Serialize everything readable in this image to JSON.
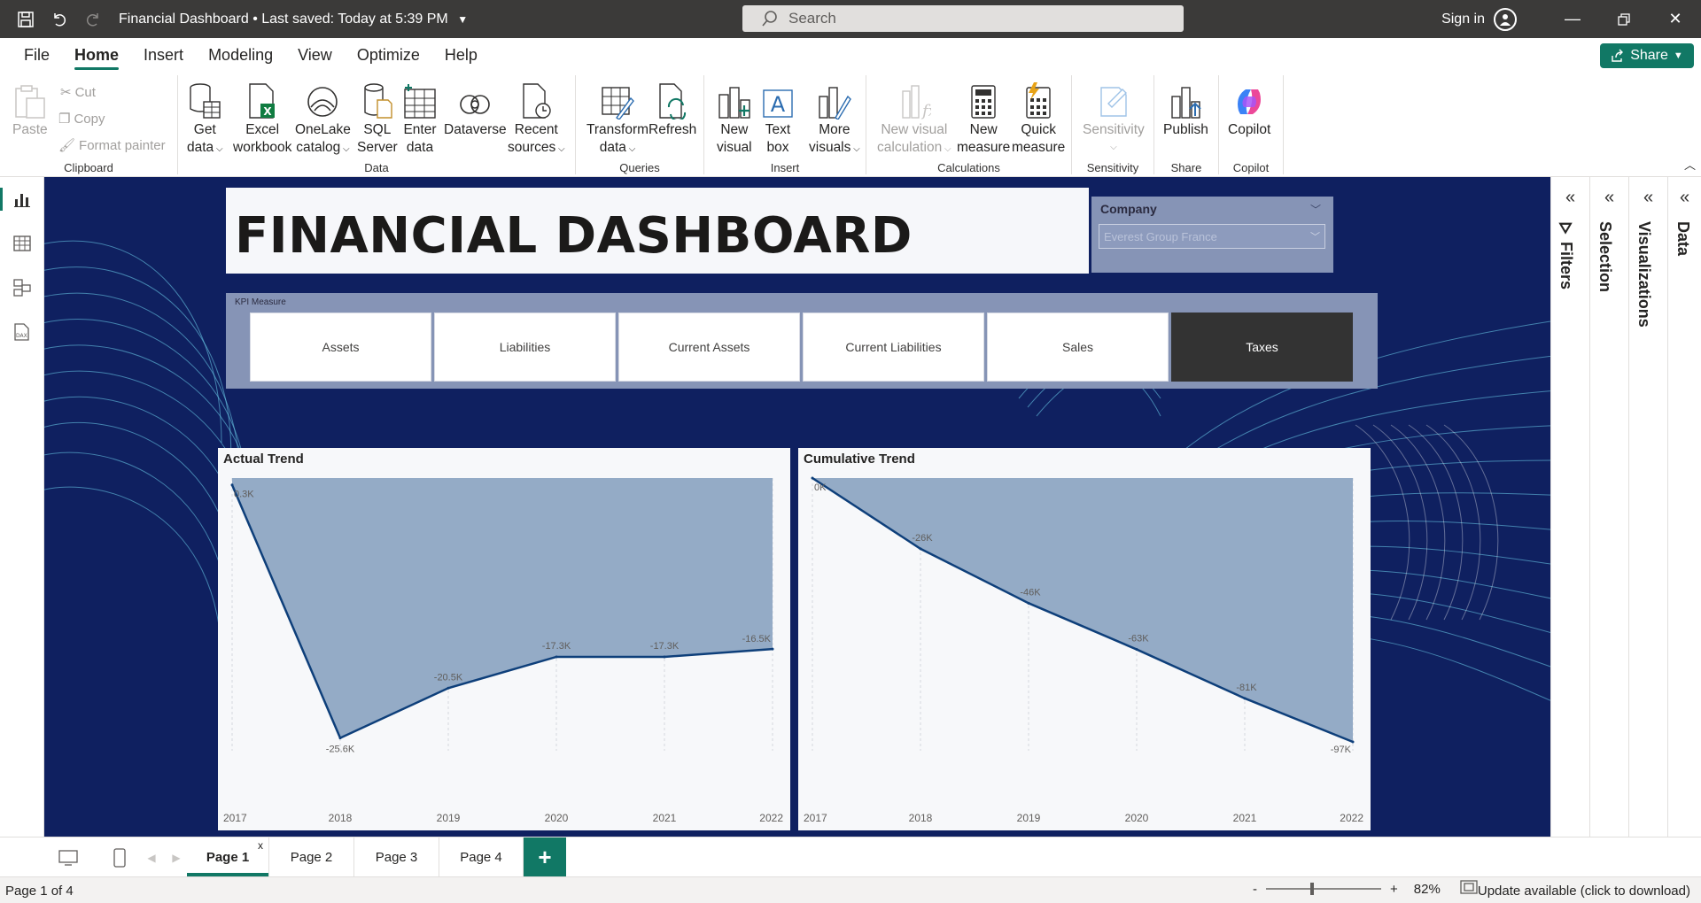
{
  "titlebar": {
    "file_title": "Financial Dashboard",
    "saved_status": "Last saved: Today at 5:39 PM",
    "search_placeholder": "Search",
    "sign_in": "Sign in"
  },
  "menu": {
    "items": [
      "File",
      "Home",
      "Insert",
      "Modeling",
      "View",
      "Optimize",
      "Help"
    ],
    "active": "Home",
    "share": "Share"
  },
  "ribbon": {
    "clipboard": {
      "paste": "Paste",
      "cut": "Cut",
      "copy": "Copy",
      "format_painter": "Format painter",
      "label": "Clipboard"
    },
    "data": {
      "get_data": [
        "Get",
        "data"
      ],
      "excel": [
        "Excel",
        "workbook"
      ],
      "onelake": [
        "OneLake",
        "catalog"
      ],
      "sql": [
        "SQL",
        "Server"
      ],
      "enter": [
        "Enter",
        "data"
      ],
      "dataverse": [
        "Dataverse",
        ""
      ],
      "recent": [
        "Recent",
        "sources"
      ],
      "label": "Data"
    },
    "queries": {
      "transform": [
        "Transform",
        "data"
      ],
      "refresh": [
        "Refresh",
        ""
      ],
      "label": "Queries"
    },
    "insert": {
      "new_visual": [
        "New",
        "visual"
      ],
      "text_box": [
        "Text",
        "box"
      ],
      "more_visuals": [
        "More",
        "visuals"
      ],
      "label": "Insert"
    },
    "calculations": {
      "new_visual_calc": [
        "New visual",
        "calculation"
      ],
      "new_measure": [
        "New",
        "measure"
      ],
      "quick_measure": [
        "Quick",
        "measure"
      ],
      "label": "Calculations"
    },
    "sensitivity": {
      "button": "Sensitivity",
      "label": "Sensitivity"
    },
    "share": {
      "publish": "Publish",
      "label": "Share"
    },
    "copilot": {
      "button": "Copilot",
      "label": "Copilot"
    }
  },
  "report": {
    "title": "FINANCIAL DASHBOARD",
    "slicer": {
      "label": "Company",
      "value": "Everest Group France"
    },
    "kpi": {
      "label": "KPI Measure",
      "options": [
        "Assets",
        "Liabilities",
        "Current Assets",
        "Current Liabilities",
        "Sales",
        "Taxes"
      ],
      "selected": "Taxes"
    }
  },
  "chart_data": [
    {
      "type": "area",
      "title": "Actual Trend",
      "x": [
        "2017",
        "2018",
        "2019",
        "2020",
        "2021",
        "2022"
      ],
      "values": [
        0.3,
        -25.6,
        -20.5,
        -17.3,
        -17.3,
        -16.5
      ],
      "data_labels": [
        "0.3K",
        "-25.6K",
        "-20.5K",
        "-17.3K",
        "-17.3K",
        "-16.5K"
      ],
      "ylim": [
        -26,
        1
      ],
      "color": "#0e3f7a",
      "fill": "#94abc6"
    },
    {
      "type": "area",
      "title": "Cumulative Trend",
      "x": [
        "2017",
        "2018",
        "2019",
        "2020",
        "2021",
        "2022"
      ],
      "values": [
        0,
        -26,
        -46,
        -63,
        -81,
        -97
      ],
      "data_labels": [
        "0K",
        "-26K",
        "-46K",
        "-63K",
        "-81K",
        "-97K"
      ],
      "ylim": [
        -97,
        0
      ],
      "color": "#0e3f7a",
      "fill": "#94abc6"
    }
  ],
  "panes": {
    "filters": "Filters",
    "selection": "Selection",
    "visualizations": "Visualizations",
    "data": "Data"
  },
  "pages": {
    "tabs": [
      "Page 1",
      "Page 2",
      "Page 3",
      "Page 4"
    ],
    "active": "Page 1",
    "add": "+",
    "close": "x"
  },
  "status": {
    "page_info": "Page 1 of 4",
    "zoom_minus": "-",
    "zoom_plus": "+",
    "zoom": "82%",
    "update": "Update available (click to download)"
  },
  "colors": {
    "accent": "#117865",
    "canvas": "#0f2060",
    "titlebar": "#3b3a39"
  }
}
